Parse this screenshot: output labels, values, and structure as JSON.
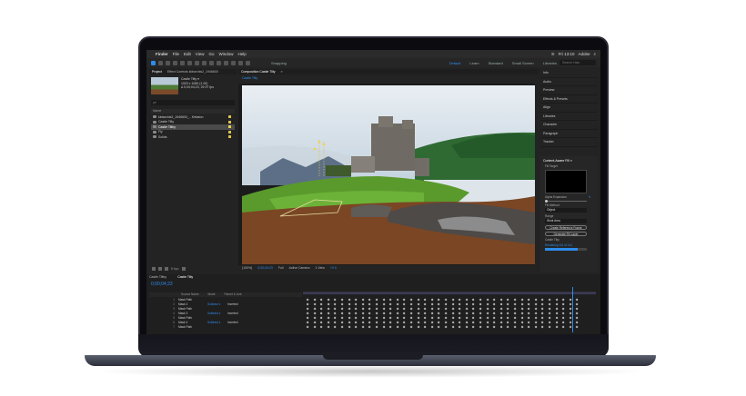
{
  "menubar": {
    "app": "Finder",
    "items": [
      "File",
      "Edit",
      "View",
      "Go",
      "Window",
      "Help"
    ],
    "clock": "Fri 13:10",
    "user": "Adobe"
  },
  "toolbar": {
    "snapping": "Snapping",
    "workspaces": [
      "Default",
      "Learn",
      "Standard",
      "Small Screen",
      "Libraries"
    ],
    "active_workspace": "Default",
    "search_placeholder": "Search Help"
  },
  "project": {
    "tabs": [
      "Project",
      "Effect Controls kidsechis2_1946600"
    ],
    "thumb_name": "Castle Tilty ▾",
    "thumb_info1": "1920 x 1080 (1.00)",
    "thumb_info2": "Δ 0;00;04;23, 29.97 fps",
    "search_placeholder": "ρ▾",
    "col_name": "Name",
    "items": [
      {
        "name": "kidsechis2_1946600_.. Kirkston",
        "color": "#d9c24a",
        "selected": false
      },
      {
        "name": "Castle Tilty",
        "color": "#d9c24a",
        "selected": false
      },
      {
        "name": "Castle Tiltby",
        "color": "#e8d25a",
        "selected": true
      },
      {
        "name": "Fly",
        "color": "#d9c24a",
        "selected": false
      },
      {
        "name": "Solids",
        "color": "#d9c24a",
        "selected": false
      }
    ],
    "bpc": "8 bpc"
  },
  "comp": {
    "tabs": [
      "Composition Castle Tilty",
      "≡"
    ],
    "breadcrumb": "Castle Tilty",
    "bar_items": [
      "(100%)",
      "0;00;04;23",
      "Full",
      "Active Camera",
      "1 View",
      "+0.0"
    ]
  },
  "panels_right": {
    "headers": [
      "Info",
      "Audio",
      "Preview",
      "Effects & Presets",
      "Align",
      "Libraries",
      "Character",
      "Paragraph",
      "Tracker"
    ],
    "cafill": {
      "title": "Content-Aware Fill ≡",
      "fill_target": "Fill Target",
      "alpha_expansion": "Alpha Expansion",
      "alpha_value": "5",
      "fill_method": "Fill Method",
      "fill_method_value": "Object",
      "range": "Range",
      "range_value": "Work Area",
      "create_ref": "Create Reference Frame",
      "generate": "Generate Fill Layer",
      "status_name": "Castle Tilty",
      "status_text": "Rendering 111 of 141",
      "progress": 0.78
    }
  },
  "timeline": {
    "tabs": [
      "Castle Tiltby",
      "Castle Tilty"
    ],
    "timecode": "0;00;04;23",
    "col_source": "Source Name",
    "col_mode": "Mode",
    "col_parent": "Parent & Link",
    "layers": [
      {
        "num": "1",
        "name": "Mask Path",
        "mode": "",
        "parent": ""
      },
      {
        "num": "2",
        "name": "Mask 2",
        "mode": "Subtract ▾",
        "parent": "Inverted"
      },
      {
        "num": "3",
        "name": "Mask Path",
        "mode": "",
        "parent": ""
      },
      {
        "num": "4",
        "name": "Mask 3",
        "mode": "Subtract ▾",
        "parent": "Inverted"
      },
      {
        "num": "5",
        "name": "Mask Path",
        "mode": "",
        "parent": ""
      },
      {
        "num": "6",
        "name": "Mask 4",
        "mode": "Subtract ▾",
        "parent": "Inverted"
      },
      {
        "num": "7",
        "name": "Mask Path",
        "mode": "",
        "parent": ""
      }
    ],
    "playhead_fraction": 0.92
  },
  "colors": {
    "accent": "#2d8ceb",
    "ui_bg": "#232323"
  }
}
